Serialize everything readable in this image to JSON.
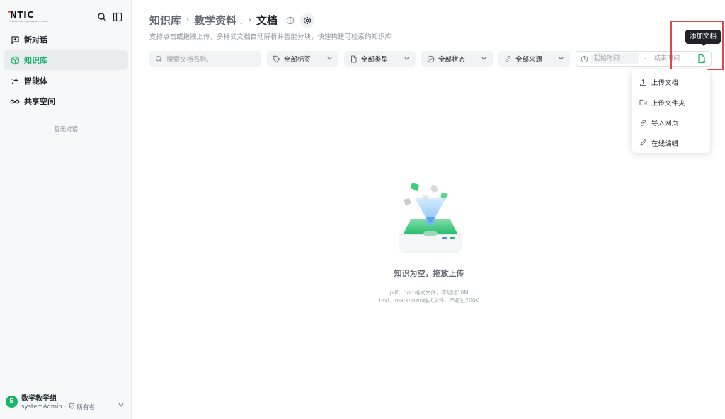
{
  "app": {
    "logo_text": "NTIC",
    "logo_sub": "Natural Teaching Intelligence Center"
  },
  "sidebar": {
    "items": [
      {
        "label": "新对话",
        "icon": "chat-plus-icon"
      },
      {
        "label": "知识库",
        "icon": "cube-icon"
      },
      {
        "label": "智能体",
        "icon": "sparkle-icon"
      },
      {
        "label": "共享空间",
        "icon": "infinity-icon"
      }
    ],
    "empty_conversations": "暂无对话",
    "user": {
      "initial": "S",
      "name": "数学教学组",
      "account": "systemAdmin",
      "role": "所有者"
    }
  },
  "header": {
    "breadcrumb": [
      "知识库",
      "教学资料",
      "文档"
    ],
    "subtitle": "支持点击或拖拽上传，多格式文档自动解析并智能分块，快速构建可检索的知识库"
  },
  "filters": {
    "search_placeholder": "搜索文档名称...",
    "tag": "全部标签",
    "type": "全部类型",
    "status": "全部状态",
    "source": "全部来源",
    "start_date_placeholder": "起始时间",
    "end_date_placeholder": "结束时间",
    "date_separator": "-"
  },
  "tooltip": "添加文档",
  "add_menu": {
    "items": [
      {
        "label": "上传文档",
        "icon": "upload-icon"
      },
      {
        "label": "上传文件夹",
        "icon": "folder-upload-icon"
      },
      {
        "label": "导入网页",
        "icon": "link-icon"
      },
      {
        "label": "在线编辑",
        "icon": "pencil-icon"
      }
    ]
  },
  "empty_state": {
    "title": "知识为空，拖放上传",
    "hint_line1": "pdf、doc 格式文件，不超过10M",
    "hint_line2": "text、markdown格式文件，不超过200K"
  },
  "colors": {
    "accent": "#1cb56b",
    "highlight": "#e04848",
    "tooltip_bg": "#1f2329"
  }
}
